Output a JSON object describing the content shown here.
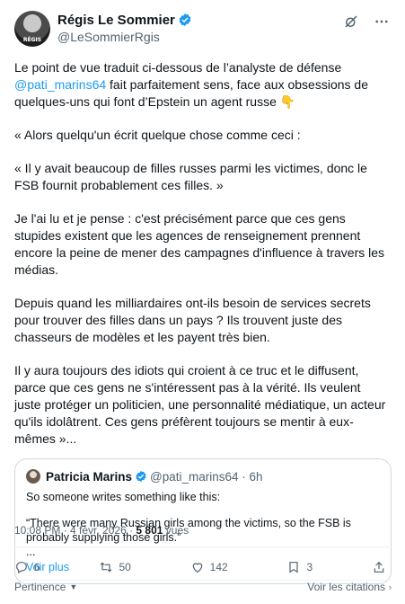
{
  "author": {
    "display_name": "Régis Le Sommier",
    "handle": "@LeSommierRgis",
    "avatar_label": "RÉGIS"
  },
  "tweet": {
    "p1_before": "Le point de vue traduit ci-dessous de l’analyste de défense ",
    "p1_mention": "@pati_marins64",
    "p1_after": " fait parfaitement sens, face aux obsessions de quelques-uns qui font d’Epstein un agent russe 👇",
    "p2": "« Alors quelqu'un écrit quelque chose comme ceci :",
    "p3": "« Il y avait beaucoup de filles russes parmi les victimes, donc le FSB fournit probablement ces filles. »",
    "p4": "Je l'ai lu et je pense : c'est précisément parce que ces gens stupides existent que les agences de renseignement prennent encore la peine de mener des campagnes d'influence à travers les médias.",
    "p5": "Depuis quand les milliardaires ont-ils besoin de services secrets pour trouver des filles dans un pays ? Ils trouvent juste des chasseurs de modèles et les payent très bien.",
    "p6": "Il y aura toujours des idiots qui croient à ce truc et le diffusent, parce que ces gens ne s'intéressent pas à la vérité. Ils veulent juste protéger un politicien, une personnalité médiatique, un acteur qu'ils idolâtrent. Ces gens préfèrent toujours se mentir à eux-mêmes »..."
  },
  "quote": {
    "name": "Patricia Marins",
    "handle_time": "@pati_marins64 · 6h",
    "line1": "So someone writes something like this:",
    "line2": "“There were many Russian girls among the victims, so the FSB is probably supplying those girls.”",
    "line3": "...",
    "more": "Voir plus"
  },
  "meta": {
    "time_date": "10:08 PM · 4 févr. 2026 · ",
    "views_count": "5 801",
    "views_label": " vues"
  },
  "actions": {
    "replies": "6",
    "reposts": "50",
    "likes": "142",
    "bookmarks": "3"
  },
  "footer": {
    "left": "Pertinence",
    "right": "Voir les citations"
  },
  "colors": {
    "accent": "#1d9bf0",
    "text": "#0f1419",
    "secondary": "#536471",
    "border": "#cfd9de"
  },
  "icons": [
    "verified-badge-icon",
    "grok-icon",
    "more-icon",
    "reply-icon",
    "repost-icon",
    "like-icon",
    "bookmark-icon",
    "share-icon",
    "chevron-down-icon"
  ]
}
